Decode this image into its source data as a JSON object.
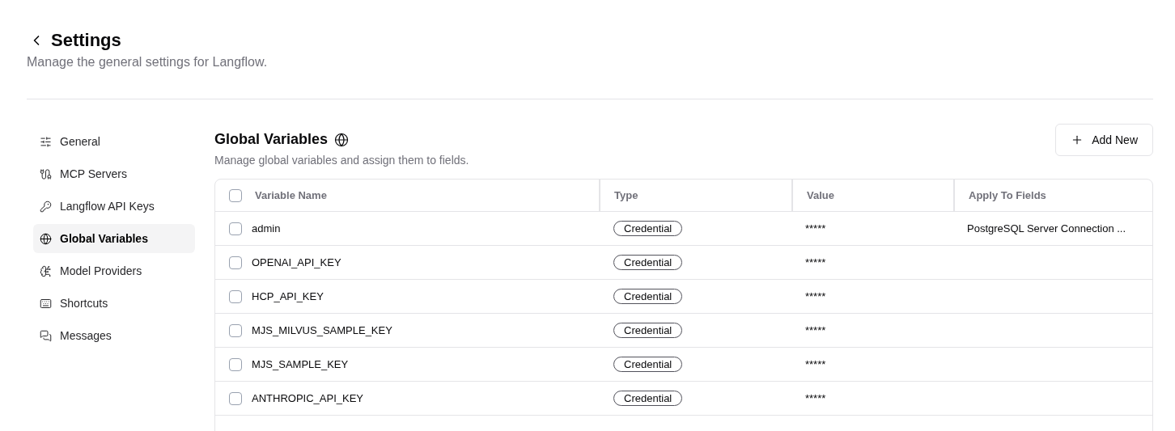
{
  "header": {
    "title": "Settings",
    "subtitle": "Manage the general settings for Langflow."
  },
  "sidebar": {
    "items": [
      {
        "label": "General",
        "selected": false
      },
      {
        "label": "MCP Servers",
        "selected": false
      },
      {
        "label": "Langflow API Keys",
        "selected": false
      },
      {
        "label": "Global Variables",
        "selected": true
      },
      {
        "label": "Model Providers",
        "selected": false
      },
      {
        "label": "Shortcuts",
        "selected": false
      },
      {
        "label": "Messages",
        "selected": false
      }
    ]
  },
  "section": {
    "title": "Global Variables",
    "description": "Manage global variables and assign them to fields.",
    "add_button": "Add New"
  },
  "table": {
    "select_all_checked": false,
    "columns": [
      "Variable Name",
      "Type",
      "Value",
      "Apply To Fields"
    ],
    "rows": [
      {
        "checked": false,
        "name": "admin",
        "type": "Credential",
        "value": "*****",
        "fields": "PostgreSQL Server Connection ..."
      },
      {
        "checked": false,
        "name": "OPENAI_API_KEY",
        "type": "Credential",
        "value": "*****"
      },
      {
        "checked": false,
        "name": "HCP_API_KEY",
        "type": "Credential",
        "value": "*****"
      },
      {
        "checked": false,
        "name": "MJS_MILVUS_SAMPLE_KEY",
        "type": "Credential",
        "value": "*****"
      },
      {
        "checked": false,
        "name": "MJS_SAMPLE_KEY",
        "type": "Credential",
        "value": "*****"
      },
      {
        "checked": false,
        "name": "ANTHROPIC_API_KEY",
        "type": "Credential",
        "value": "*****"
      }
    ]
  }
}
